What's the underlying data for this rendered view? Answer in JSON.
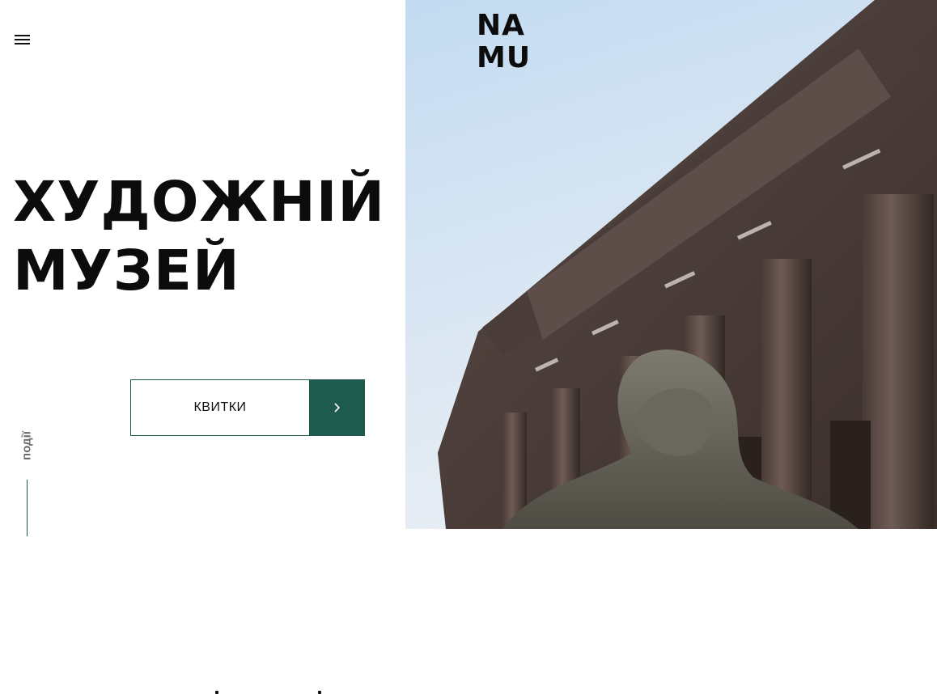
{
  "header": {
    "menu_icon": "hamburger-menu-icon",
    "logo_line1": "NA",
    "logo_line2": "MU"
  },
  "hero": {
    "title_line1": "ХУДОЖНІЙ",
    "title_line2": "МУЗЕЙ",
    "tickets_label": "КВИТКИ",
    "tickets_arrow_icon": "chevron-right-icon",
    "events_label": "події"
  },
  "photo": {
    "subject": "museum facade with columns and lion sculpture",
    "sky_color": "#b9d4ec"
  },
  "colors": {
    "accent": "#1f5a4f",
    "text": "#0c0c0c",
    "muted": "#6b6b6b",
    "background": "#ffffff"
  }
}
